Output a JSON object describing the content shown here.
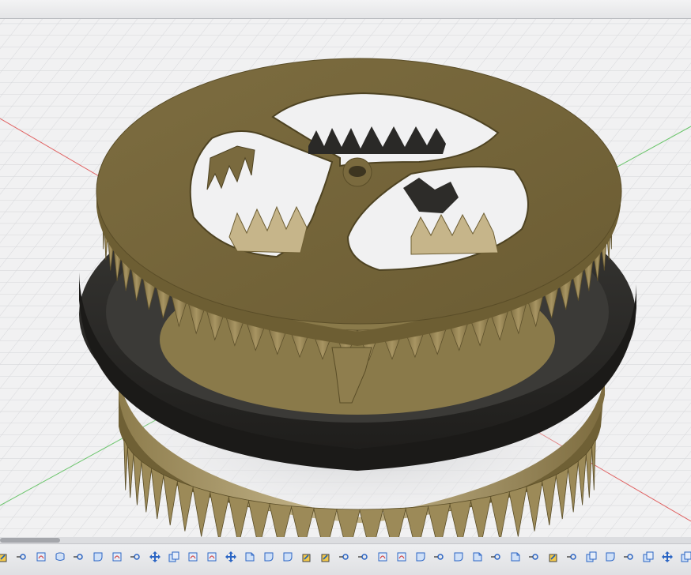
{
  "window": {
    "title": ""
  },
  "scene": {
    "part_color": "#7a6a3e",
    "rubber_ring_color": "#2e2d2b",
    "x_axis_color": "#e05a5a",
    "y_axis_color": "#5cc15c",
    "grid_color": "#d3d4d7",
    "background_color": "#f1f1f2"
  },
  "timeline": {
    "items": [
      "extrude",
      "joint",
      "sketch",
      "revolve",
      "joint",
      "fillet",
      "sketch",
      "joint",
      "move",
      "copy",
      "sketch",
      "sketch",
      "move",
      "chamfer",
      "fillet",
      "fillet",
      "extrude",
      "extrude",
      "joint",
      "joint",
      "sketch",
      "sketch",
      "fillet",
      "joint",
      "fillet",
      "chamfer",
      "joint",
      "chamfer",
      "joint",
      "extrude",
      "joint",
      "copy",
      "fillet",
      "joint",
      "copy",
      "move",
      "copy"
    ]
  }
}
